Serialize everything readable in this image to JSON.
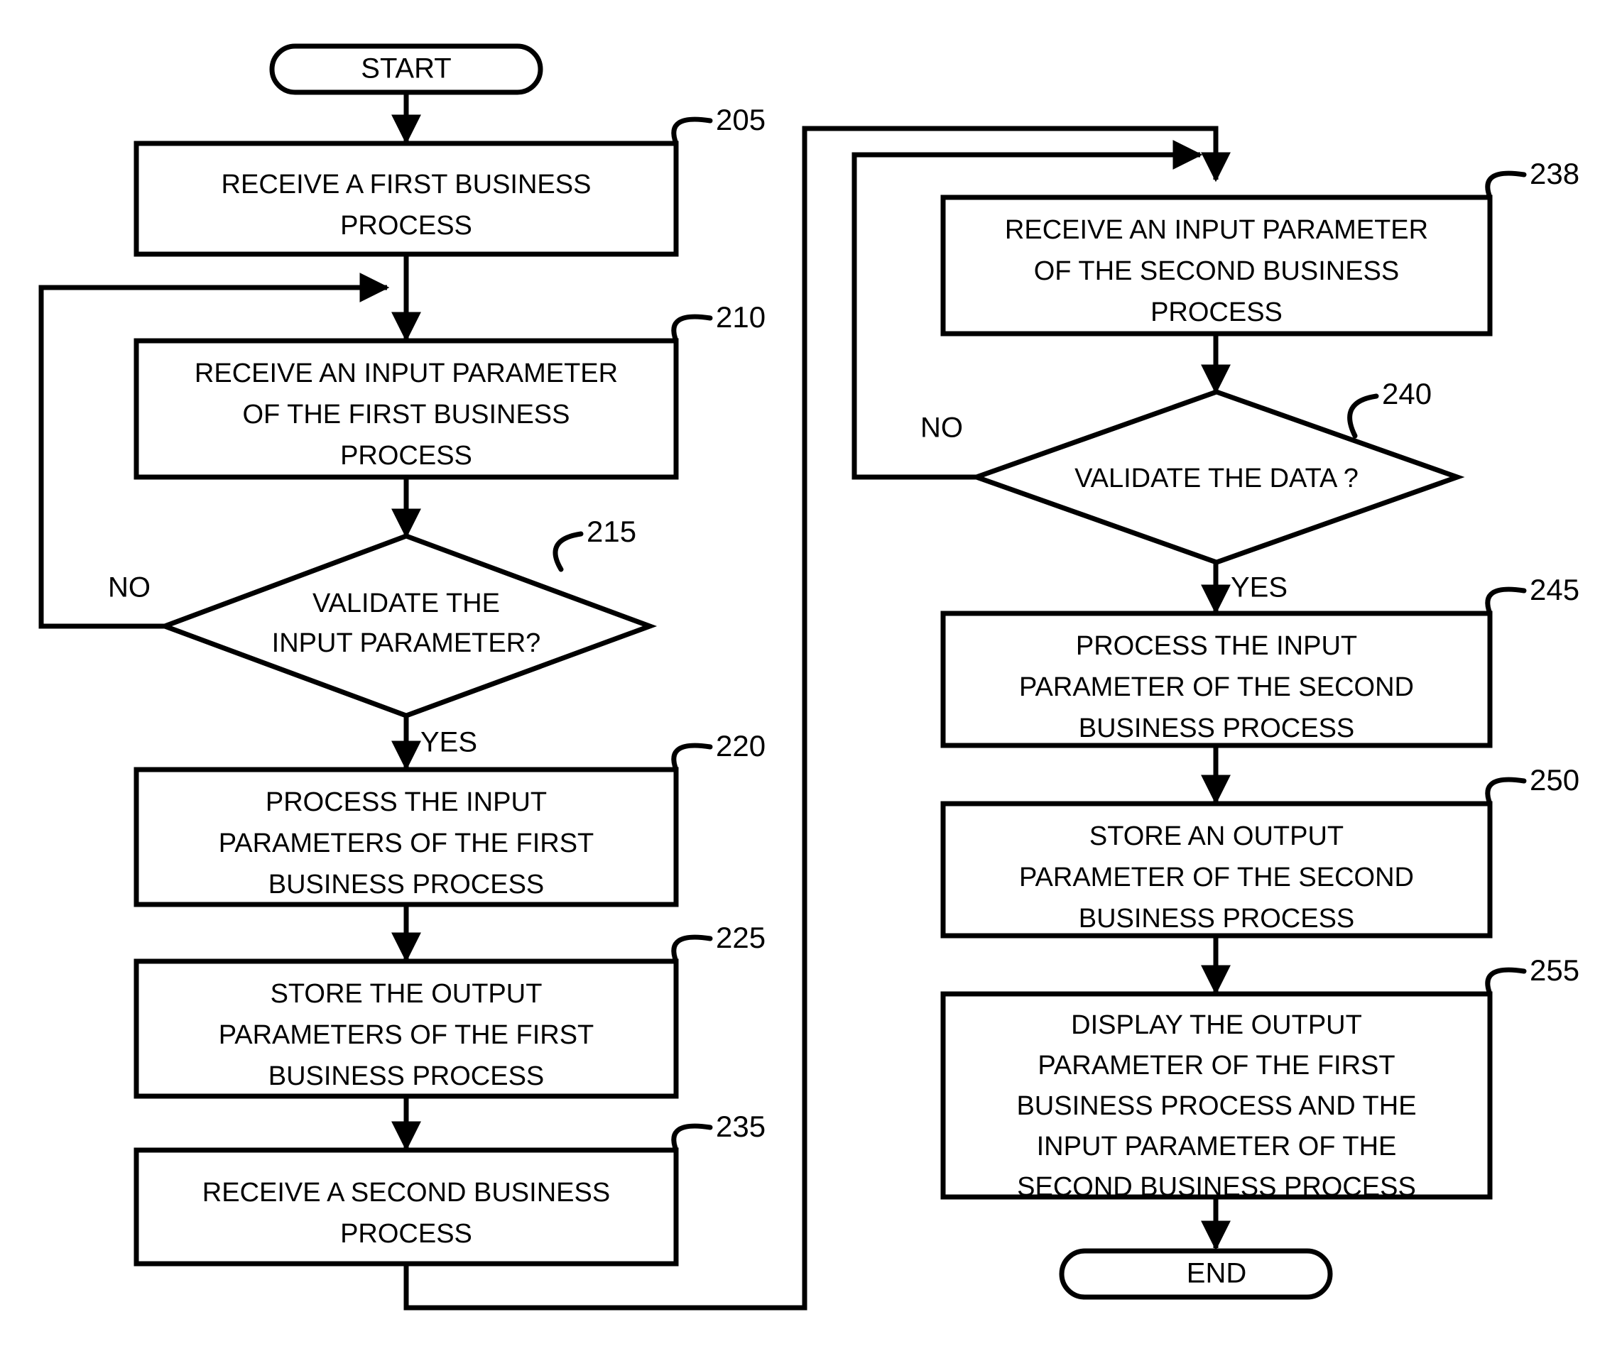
{
  "diagram": {
    "title": "",
    "type": "flowchart",
    "stroke_color": "#000000",
    "fill_color": "#ffffff",
    "background": "#ffffff",
    "terminals": {
      "start": "START",
      "end": "END"
    },
    "branch_labels": {
      "no_left": "NO",
      "yes_left": "YES",
      "no_right": "NO",
      "yes_right": "YES"
    },
    "nodes": [
      {
        "id": "n205",
        "ref": "205",
        "shape": "process",
        "lines": [
          "RECEIVE A FIRST BUSINESS",
          "PROCESS"
        ]
      },
      {
        "id": "n210",
        "ref": "210",
        "shape": "process",
        "lines": [
          "RECEIVE AN INPUT PARAMETER",
          "OF THE FIRST BUSINESS",
          "PROCESS"
        ]
      },
      {
        "id": "n215",
        "ref": "215",
        "shape": "decision",
        "lines": [
          "VALIDATE THE",
          "INPUT PARAMETER?"
        ]
      },
      {
        "id": "n220",
        "ref": "220",
        "shape": "process",
        "lines": [
          "PROCESS THE INPUT",
          "PARAMETERS OF THE FIRST",
          "BUSINESS PROCESS"
        ]
      },
      {
        "id": "n225",
        "ref": "225",
        "shape": "process",
        "lines": [
          "STORE THE OUTPUT",
          "PARAMETERS OF THE FIRST",
          "BUSINESS PROCESS"
        ]
      },
      {
        "id": "n235",
        "ref": "235",
        "shape": "process",
        "lines": [
          "RECEIVE A SECOND BUSINESS",
          "PROCESS"
        ]
      },
      {
        "id": "n238",
        "ref": "238",
        "shape": "process",
        "lines": [
          "RECEIVE AN INPUT PARAMETER",
          "OF THE SECOND BUSINESS",
          "PROCESS"
        ]
      },
      {
        "id": "n240",
        "ref": "240",
        "shape": "decision",
        "lines": [
          "VALIDATE THE DATA ?"
        ]
      },
      {
        "id": "n245",
        "ref": "245",
        "shape": "process",
        "lines": [
          "PROCESS THE INPUT",
          "PARAMETER OF THE SECOND",
          "BUSINESS PROCESS"
        ]
      },
      {
        "id": "n250",
        "ref": "250",
        "shape": "process",
        "lines": [
          "STORE AN OUTPUT",
          "PARAMETER OF THE SECOND",
          "BUSINESS PROCESS"
        ]
      },
      {
        "id": "n255",
        "ref": "255",
        "shape": "process",
        "lines": [
          "DISPLAY THE OUTPUT",
          "PARAMETER OF THE FIRST",
          "BUSINESS PROCESS AND THE",
          "INPUT PARAMETER OF THE",
          "SECOND BUSINESS PROCESS"
        ]
      }
    ]
  }
}
